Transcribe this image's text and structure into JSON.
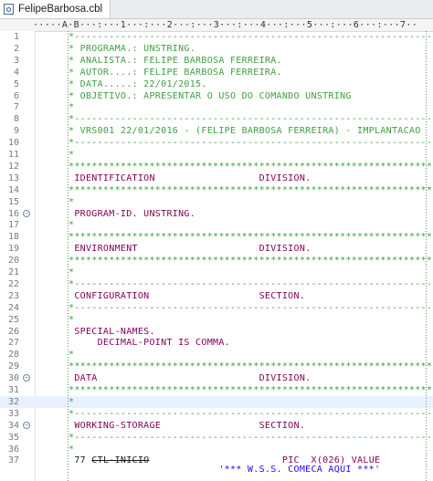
{
  "editor": {
    "tab_title": "FelipeBarbosa.cbl",
    "ruler": "·····A·B···:···1···:···2···:···3···:···4···:···5···:···6···:···7··",
    "current_line": 32,
    "fold_lines": [
      16,
      30,
      34
    ],
    "lines": [
      {
        "n": "1",
        "t": "comment",
        "text": "*---------------------------------------------------------------"
      },
      {
        "n": "2",
        "t": "comment",
        "text": "* PROGRAMA.: UNSTRING."
      },
      {
        "n": "3",
        "t": "comment",
        "text": "* ANALISTA.: FELIPE BARBOSA FERREIRA."
      },
      {
        "n": "4",
        "t": "comment",
        "text": "* AUTOR....: FELIPE BARBOSA FERREIRA."
      },
      {
        "n": "5",
        "t": "comment",
        "text": "* DATA.....: 22/01/2015."
      },
      {
        "n": "6",
        "t": "comment",
        "text": "* OBJETIVO.: APRESENTAR O USO DO COMANDO UNSTRING"
      },
      {
        "n": "7",
        "t": "comment",
        "text": "*"
      },
      {
        "n": "8",
        "t": "comment",
        "text": "*---------------------------------------------------------------"
      },
      {
        "n": "9",
        "t": "comment",
        "text": "* VRS001 22/01/2016 - (FELIPE BARBOSA FERREIRA) - IMPLANTACAO"
      },
      {
        "n": "10",
        "t": "comment",
        "text": "*---------------------------------------------------------------"
      },
      {
        "n": "11",
        "t": "comment",
        "text": "*"
      },
      {
        "n": "12",
        "t": "comment",
        "text": "****************************************************************"
      },
      {
        "n": "13",
        "t": "keyword",
        "text": " IDENTIFICATION                  DIVISION."
      },
      {
        "n": "14",
        "t": "comment",
        "text": "****************************************************************"
      },
      {
        "n": "15",
        "t": "comment",
        "text": "*"
      },
      {
        "n": "16",
        "t": "keyword",
        "text": " PROGRAM-ID. UNSTRING."
      },
      {
        "n": "17",
        "t": "comment",
        "text": "*"
      },
      {
        "n": "18",
        "t": "comment",
        "text": "****************************************************************"
      },
      {
        "n": "19",
        "t": "keyword",
        "text": " ENVIRONMENT                     DIVISION."
      },
      {
        "n": "20",
        "t": "comment",
        "text": "****************************************************************"
      },
      {
        "n": "21",
        "t": "comment",
        "text": "*"
      },
      {
        "n": "22",
        "t": "comment",
        "text": "*---------------------------------------------------------------"
      },
      {
        "n": "23",
        "t": "keyword",
        "text": " CONFIGURATION                   SECTION."
      },
      {
        "n": "24",
        "t": "comment",
        "text": "*---------------------------------------------------------------"
      },
      {
        "n": "25",
        "t": "comment",
        "text": "*"
      },
      {
        "n": "26",
        "t": "keyword",
        "text": " SPECIAL-NAMES."
      },
      {
        "n": "27",
        "t": "keyword",
        "text": "     DECIMAL-POINT IS COMMA."
      },
      {
        "n": "28",
        "t": "comment",
        "text": "*"
      },
      {
        "n": "29",
        "t": "comment",
        "text": "****************************************************************"
      },
      {
        "n": "30",
        "t": "keyword",
        "text": " DATA                            DIVISION."
      },
      {
        "n": "31",
        "t": "comment",
        "text": "****************************************************************"
      },
      {
        "n": "32",
        "t": "comment",
        "text": "*"
      },
      {
        "n": "33",
        "t": "comment",
        "text": "*---------------------------------------------------------------"
      },
      {
        "n": "34",
        "t": "keyword",
        "text": " WORKING-STORAGE                 SECTION."
      },
      {
        "n": "35",
        "t": "comment",
        "text": "*---------------------------------------------------------------"
      },
      {
        "n": "36",
        "t": "comment",
        "text": "*"
      }
    ],
    "line37": {
      "n": "37",
      "level": " 77 ",
      "name": "CTL-INICIO",
      "pad": "                       ",
      "pic": "PIC  X(026) VALUE"
    },
    "line37b": {
      "text": "                          '*** W.S.S. COMECA AQUI ***'"
    }
  }
}
